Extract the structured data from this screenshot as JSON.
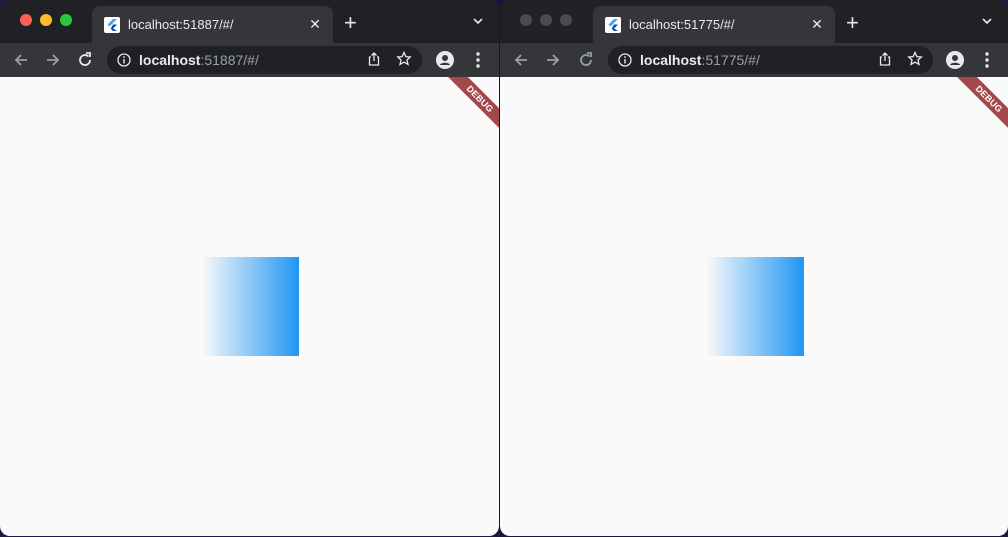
{
  "colors": {
    "close": "#ff5f57",
    "minimize": "#febc2e",
    "zoom": "#28c840",
    "inactive_light": "#4a4b4f",
    "gradient_end": "#2196f3",
    "debug_banner": "#a3484a"
  },
  "windows": [
    {
      "active": true,
      "tab_title": "localhost:51887/#/",
      "url_host": "localhost",
      "url_rest": ":51887/#/",
      "debug_label": "DEBUG"
    },
    {
      "active": false,
      "tab_title": "localhost:51775/#/",
      "url_host": "localhost",
      "url_rest": ":51775/#/",
      "debug_label": "DEBUG"
    }
  ],
  "icons": {
    "back": "arrow-left",
    "forward": "arrow-right",
    "reload": "reload",
    "info": "info",
    "share": "share",
    "bookmark": "star",
    "profile": "person",
    "menu": "kebab",
    "new_tab": "plus",
    "tab_search": "chevron-down",
    "close_tab": "x"
  }
}
